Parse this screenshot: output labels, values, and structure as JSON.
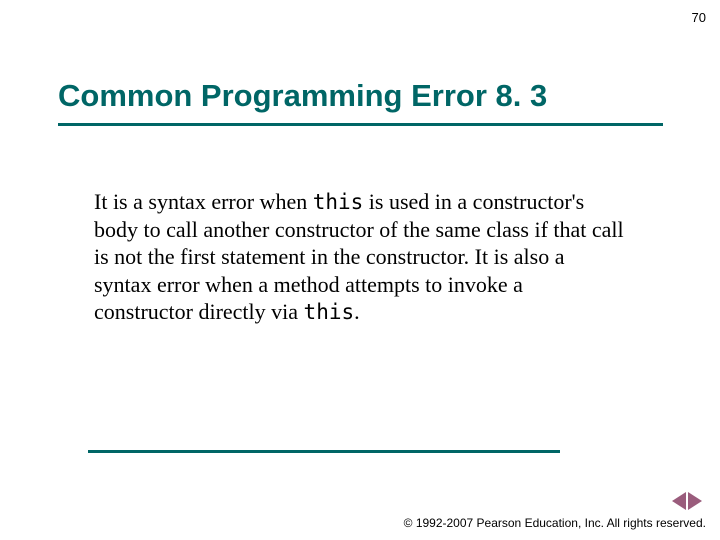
{
  "page_number": "70",
  "title": "Common Programming Error 8. 3",
  "body": {
    "part1": "It is a syntax error when ",
    "code1": "this",
    "part2": " is used in a constructor's body to call another constructor of the same class if that call is not the first statement in the constructor. It is also a syntax error when a method attempts to invoke a constructor directly via ",
    "code2": "this",
    "part3": "."
  },
  "copyright": "© 1992-2007 Pearson Education, Inc.  All rights reserved."
}
